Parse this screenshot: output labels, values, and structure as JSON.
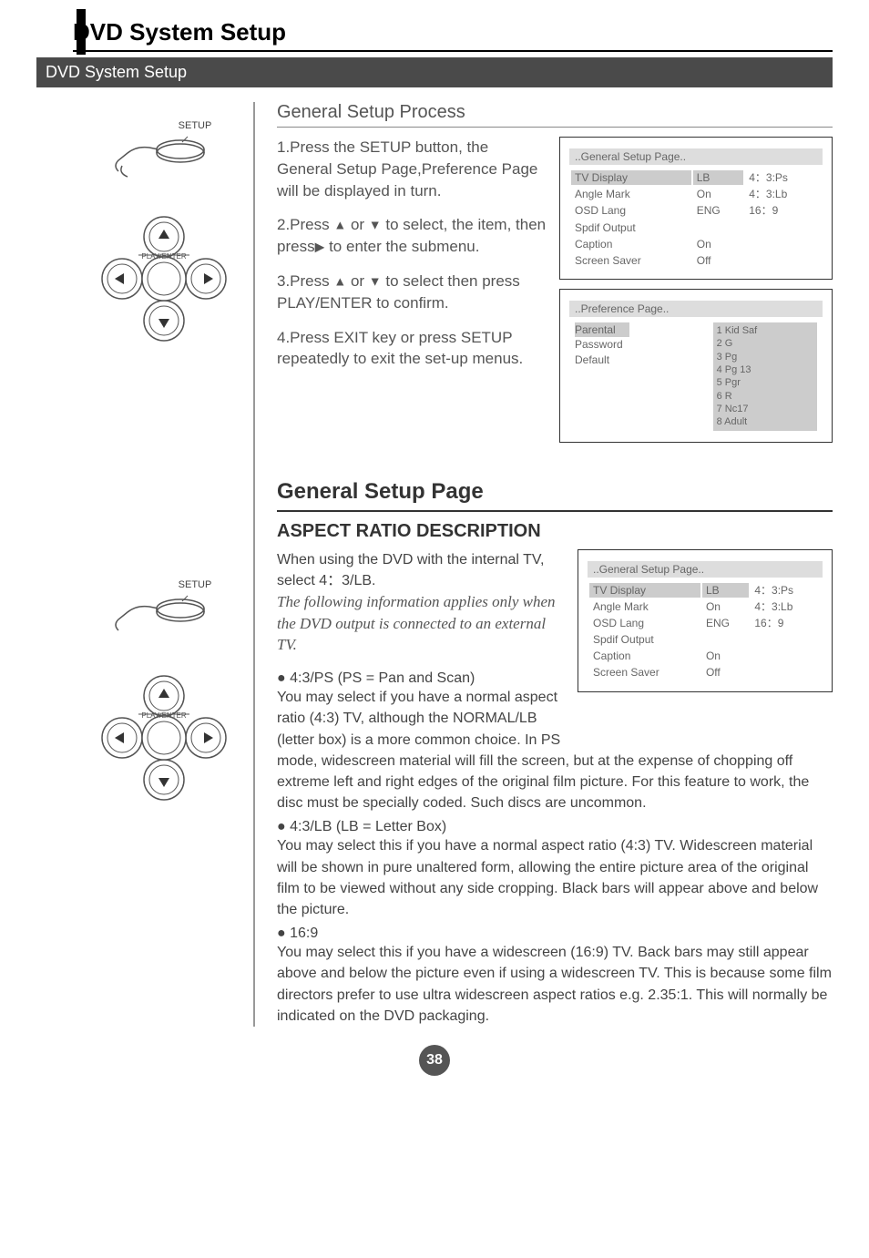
{
  "header": {
    "main_title": "DVD System Setup",
    "subtitle": "DVD System Setup"
  },
  "remote": {
    "setup_label": "SETUP",
    "dpad_label": "PLAY/ENTER"
  },
  "general_process": {
    "heading": "General Setup Process",
    "step1": "1.Press the SETUP button, the General Setup Page,Preference Page  will be displayed in turn.",
    "step2a": "2.Press ",
    "step2b": "   to select, the item, then press",
    "step2c": " to enter the submenu.",
    "step2_or": " or ",
    "step3a": "3.Press ",
    "step3b": "  to select then press PLAY/ENTER to confirm.",
    "step3_or": " or ",
    "step4": "4.Press EXIT key or press SETUP repeatedly  to exit  the set-up menus."
  },
  "osd_general": {
    "title": "..General Setup Page..",
    "rows": {
      "r1a": "TV Display",
      "r1b": "LB",
      "r1c": "4：3:Ps",
      "r2a": "Angle Mark",
      "r2b": "On",
      "r2c": "4：3:Lb",
      "r3a": "OSD Lang",
      "r3b": "ENG",
      "r3c": "16：9",
      "r4a": "Spdif Output",
      "r5a": "Caption",
      "r5b": "On",
      "r6a": "Screen Saver",
      "r6b": "Off"
    }
  },
  "osd_pref": {
    "title": "..Preference Page..",
    "left": {
      "l1": "Parental",
      "l2": "Password",
      "l3": "Default"
    },
    "right": "1 Kid Saf\n2 G\n3 Pg\n4 Pg 13\n5 Pgr\n6 R\n7 Nc17\n8 Adult"
  },
  "section_general": {
    "title": "General Setup Page",
    "aspect_title": "ASPECT RATIO DESCRIPTION",
    "intro": "When using the DVD with the internal TV, select 4：3/LB.",
    "italic": "The following information applies only when the DVD output is connected to an external TV.",
    "b1_head": "4:3/PS (PS = Pan and Scan)",
    "b1_body_a": "You may select if you have a normal aspect ratio (4:3) TV, although the NORMAL/LB (letter box) is a more common choice. In PS",
    "b1_body_b": "mode, widescreen material will fill the screen, but at the expense of chopping off extreme left and right edges of the original film picture. For this feature to work, the disc must be specially coded. Such discs are uncommon.",
    "b2_head": "4:3/LB (LB = Letter Box)",
    "b2_body": "You may select this if you have a normal aspect ratio (4:3) TV. Widescreen material will be shown in pure unaltered form, allowing the entire picture area of the original film to be viewed without any side cropping. Black bars will appear above and below the picture.",
    "b3_head": "16:9",
    "b3_body": "You may select this if you have a widescreen (16:9) TV. Back bars may still appear above and below the picture even if using a widescreen TV. This is because some film directors prefer to use ultra widescreen aspect ratios e.g. 2.35:1. This will normally be indicated on the DVD packaging."
  },
  "page_number": "38"
}
